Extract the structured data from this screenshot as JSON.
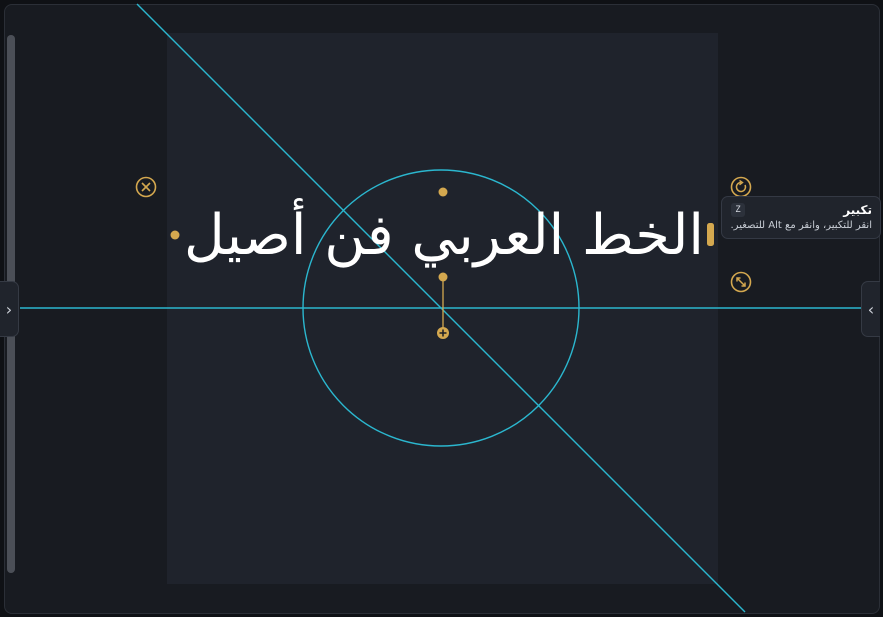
{
  "canvas": {
    "text": "الخط العربي فن أصيل"
  },
  "tooltip": {
    "title": "تكبير",
    "shortcut": "Z",
    "description": "انقر للتكبير، وانقر مع Alt للتصغير."
  },
  "icons": {
    "close": "close-circle-icon",
    "rotate": "rotate-icon",
    "resize": "resize-diagonal-icon",
    "collapse_left": "chevron-right-icon",
    "collapse_right": "chevron-left-icon",
    "center": "plus-circle-icon"
  },
  "panel_toggles": {
    "left_glyph": "›",
    "right_glyph": "‹"
  },
  "colors": {
    "background": "#181b21",
    "artboard": "#1f232c",
    "guide": "#2bb7cf",
    "handle": "#d4a84f",
    "text": "#ffffff"
  }
}
